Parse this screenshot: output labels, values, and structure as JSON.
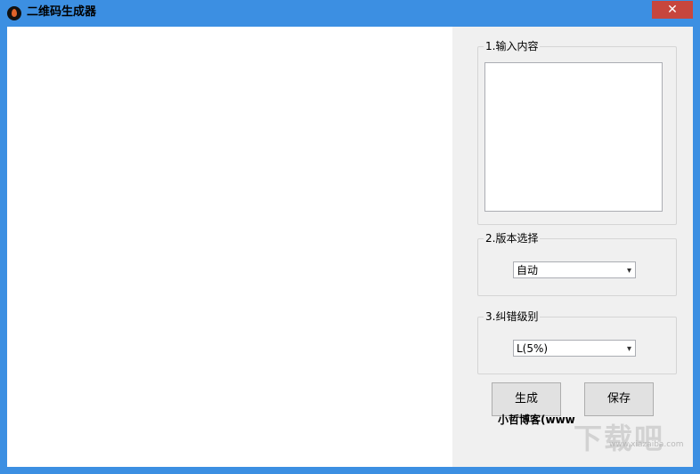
{
  "window": {
    "title": "二维码生成器",
    "close_glyph": "✕"
  },
  "input_group": {
    "label": "1.输入内容",
    "value": ""
  },
  "version_group": {
    "label": "2.版本选择",
    "selected": "自动"
  },
  "ecc_group": {
    "label": "3.纠错级别",
    "selected": "L(5%)"
  },
  "buttons": {
    "generate": "生成",
    "save": "保存"
  },
  "footer": {
    "text": "小哲博客(www"
  },
  "watermark": {
    "logo": "下载吧",
    "url": "www.xiazaiba.com"
  }
}
